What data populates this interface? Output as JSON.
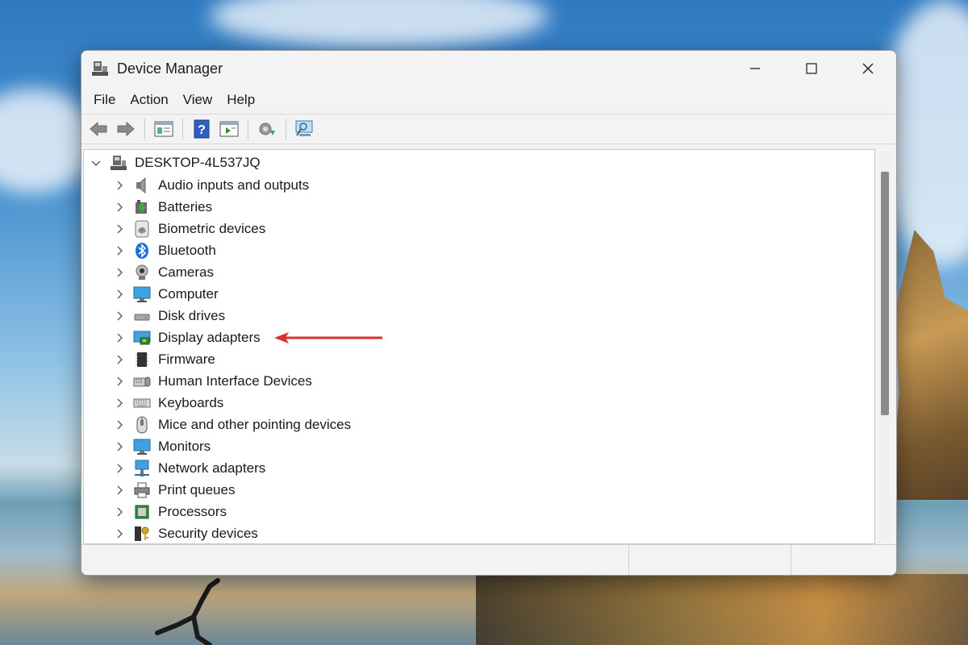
{
  "window": {
    "title": "Device Manager",
    "menu": [
      "File",
      "Action",
      "View",
      "Help"
    ],
    "toolbar_icons": [
      "back-icon",
      "forward-icon",
      "properties-icon",
      "help-icon",
      "show-hidden-icon",
      "update-driver-icon",
      "scan-hardware-icon"
    ]
  },
  "tree": {
    "root": "DESKTOP-4L537JQ",
    "categories": [
      {
        "label": "Audio inputs and outputs",
        "icon": "speaker-icon"
      },
      {
        "label": "Batteries",
        "icon": "battery-icon"
      },
      {
        "label": "Biometric devices",
        "icon": "fingerprint-icon"
      },
      {
        "label": "Bluetooth",
        "icon": "bluetooth-icon"
      },
      {
        "label": "Cameras",
        "icon": "camera-icon"
      },
      {
        "label": "Computer",
        "icon": "computer-icon"
      },
      {
        "label": "Disk drives",
        "icon": "disk-drive-icon"
      },
      {
        "label": "Display adapters",
        "icon": "display-adapter-icon"
      },
      {
        "label": "Firmware",
        "icon": "firmware-icon"
      },
      {
        "label": "Human Interface Devices",
        "icon": "hid-icon"
      },
      {
        "label": "Keyboards",
        "icon": "keyboard-icon"
      },
      {
        "label": "Mice and other pointing devices",
        "icon": "mouse-icon"
      },
      {
        "label": "Monitors",
        "icon": "monitor-icon"
      },
      {
        "label": "Network adapters",
        "icon": "network-adapter-icon"
      },
      {
        "label": "Print queues",
        "icon": "printer-icon"
      },
      {
        "label": "Processors",
        "icon": "processor-icon"
      },
      {
        "label": "Security devices",
        "icon": "security-device-icon"
      }
    ]
  },
  "annotation": {
    "target": "Display adapters",
    "color": "#d9322e"
  },
  "colors": {
    "window_bg": "#f3f3f3",
    "tree_bg": "#ffffff",
    "scroll_thumb": "#8b8b8b"
  }
}
